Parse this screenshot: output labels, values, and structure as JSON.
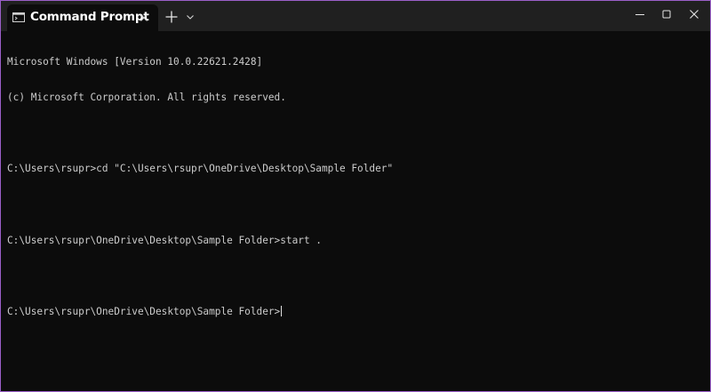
{
  "window": {
    "tab_title": "Command Prompt",
    "tab_icon": "terminal-icon",
    "new_tab_icon": "plus-icon",
    "dropdown_icon": "chevron-down-icon",
    "controls": [
      "minimize-icon",
      "maximize-icon",
      "close-icon"
    ]
  },
  "console": {
    "lines": [
      "Microsoft Windows [Version 10.0.22621.2428]",
      "(c) Microsoft Corporation. All rights reserved.",
      "",
      "C:\\Users\\rsupr>cd \"C:\\Users\\rsupr\\OneDrive\\Desktop\\Sample Folder\"",
      "",
      "C:\\Users\\rsupr\\OneDrive\\Desktop\\Sample Folder>start .",
      "",
      "C:\\Users\\rsupr\\OneDrive\\Desktop\\Sample Folder>"
    ]
  },
  "colors": {
    "background": "#0c0c0c",
    "titlebar": "#202020",
    "text": "#cccccc",
    "border": "#9b5fc9"
  }
}
